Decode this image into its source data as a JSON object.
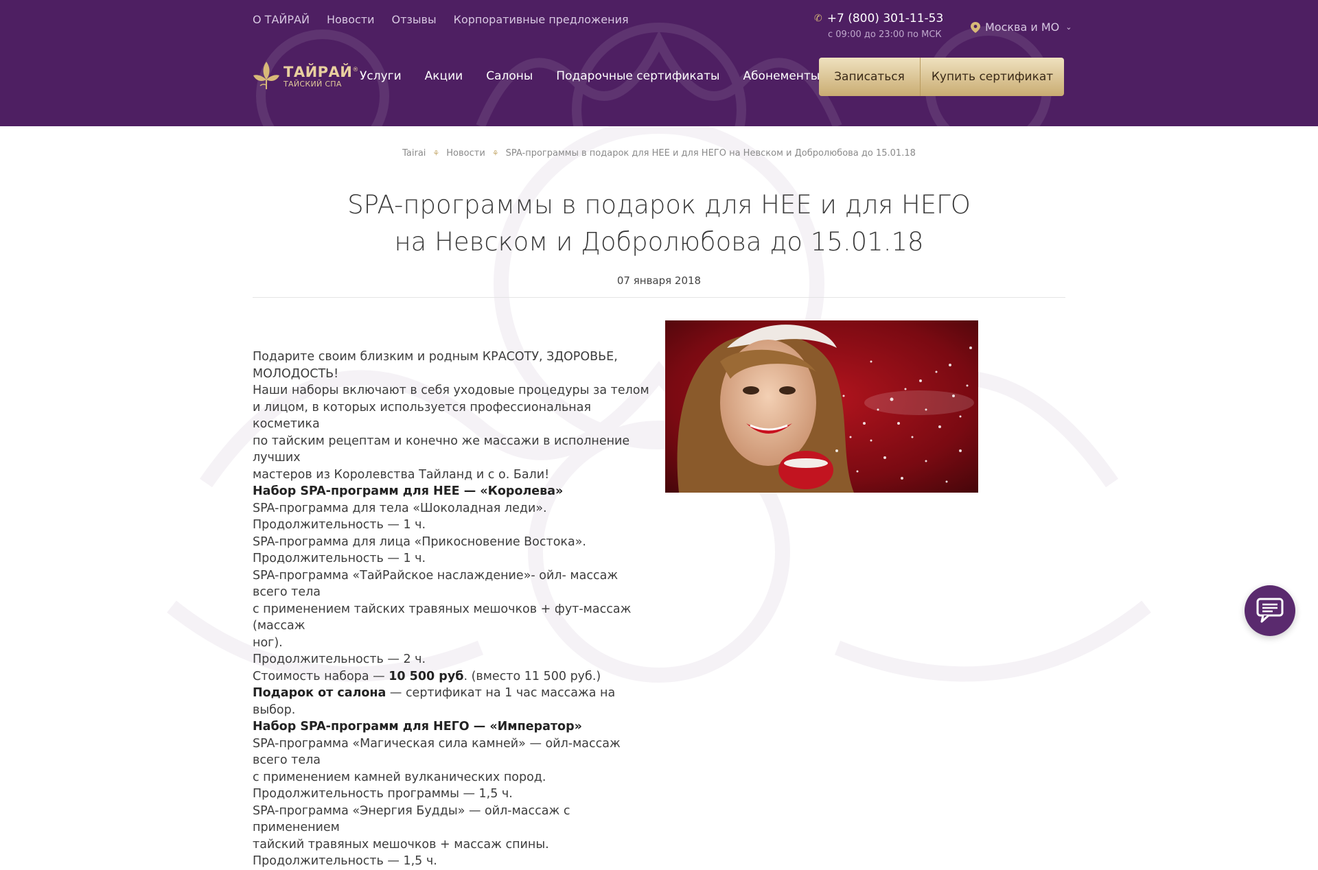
{
  "header": {
    "top_links": [
      "О ТАЙРАЙ",
      "Новости",
      "Отзывы",
      "Корпоративные предложения"
    ],
    "phone": "+7 (800) 301-11-53",
    "hours": "с 09:00 до 23:00 по МСК",
    "city": "Москва и МО",
    "logo": {
      "name": "ТАЙРАЙ",
      "registered": "®",
      "subtitle": "ТАЙСКИЙ СПА"
    },
    "nav": [
      "Услуги",
      "Акции",
      "Салоны",
      "Подарочные сертификаты",
      "Абонементы"
    ],
    "btn_signup": "Записаться",
    "btn_cert": "Купить сертификат"
  },
  "breadcrumb": {
    "home": "Tairai",
    "section": "Новости",
    "current": "SPA-программы в подарок для НЕЕ и для НЕГО на Невском и Добролюбова до 15.01.18"
  },
  "article": {
    "title_line1": "SPA-программы в подарок для НЕЕ и для НЕГО",
    "title_line2": "на Невском и Добролюбова до 15.01.18",
    "date": "07 января 2018",
    "lines": {
      "l1": "Подарите своим близким и родным КРАСОТУ, ЗДОРОВЬЕ,",
      "l2": "МОЛОДОСТЬ!",
      "l3": "Наши наборы включают в себя уходовые процедуры за телом",
      "l4": "и лицом, в которых используется профессиональная косметика",
      "l5": "по тайским рецептам и конечно же массажи в исполнение лучших",
      "l6": "мастеров из Королевства Тайланд и с о. Бали!",
      "l7": "Набор SPA-программ для НЕЕ — «Королева»",
      "l8": "SPA-программа для тела «Шоколадная леди».",
      "l9": "Продолжительность — 1 ч.",
      "l10": "SPA-программа для лица «Прикосновение Востока».",
      "l11": "Продолжительность — 1 ч.",
      "l12": "SPA-программа «ТайРайское наслаждение»- ойл- массаж всего тела",
      "l13": "с применением тайских травяных мешочков + фут-массаж (массаж",
      "l14": "ног).",
      "l15": "Продолжительность — 2 ч.",
      "l16_a": "Стоимость набора — ",
      "l16_b": "10 500 руб",
      "l16_c": ". (вместо 11 500 руб.)",
      "l17_a": "Подарок от салона",
      "l17_b": " — сертификат на 1 час массажа на выбор.",
      "l18": "Набор SPA-программ для НЕГО — «Император»",
      "l19": "SPA-программа «Магическая сила камней» — ойл-массаж всего тела",
      "l20": "с применением камней вулканических пород.",
      "l21": "Продолжительность программы — 1,5 ч.",
      "l22": "SPA-программа «Энергия Будды» — ойл-массаж с применением",
      "l23": "тайский травяных мешочков + массаж спины.",
      "l24": "Продолжительность — 1,5 ч."
    }
  },
  "icons": {
    "phone": "phone-icon",
    "city": "location-pin-icon",
    "chevron": "chevron-down-icon",
    "breadcrumb_sep": "lotus-separator-icon",
    "chat": "chat-icon"
  },
  "colors": {
    "header_bg": "#4e1f62",
    "gold": "#d8b978",
    "button_gold": "#e5d2a6",
    "chat_bg": "#5a2a6e"
  }
}
